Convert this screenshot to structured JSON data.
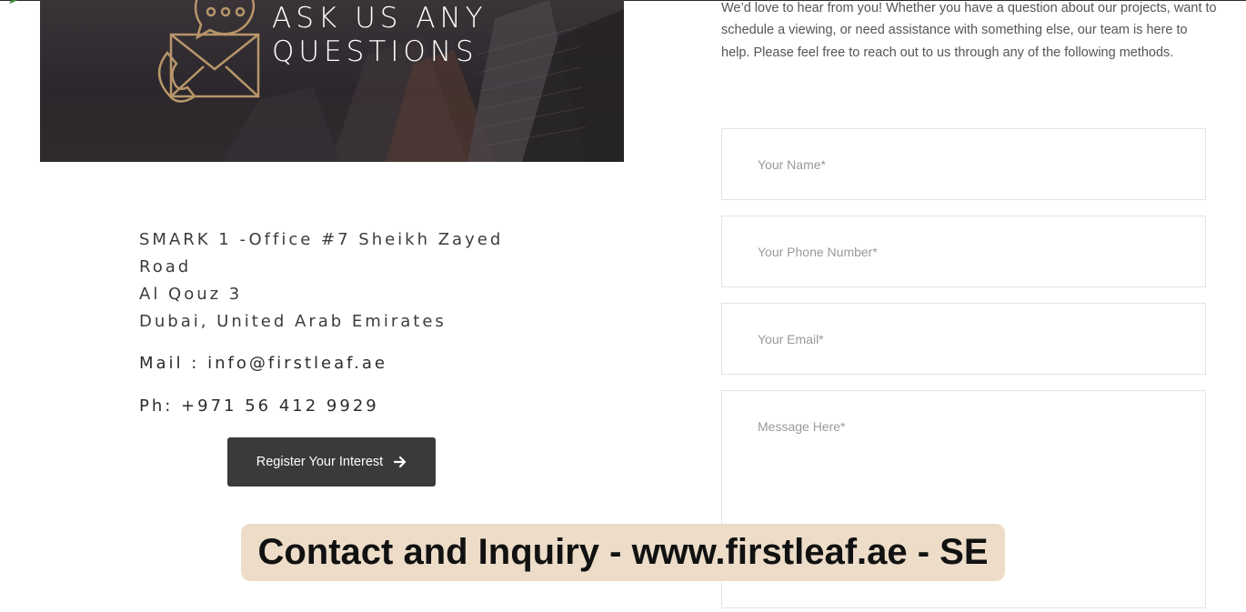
{
  "hero": {
    "title_line1": "ASK US ANY",
    "title_line2": "QUESTIONS",
    "icon": "envelope-chat-icon"
  },
  "contact": {
    "address_lines": [
      "SMARK 1 -Office #7 Sheikh Zayed",
      "Road",
      "Al Qouz 3",
      "Dubai, United Arab Emirates"
    ],
    "mail": "Mail : info@firstleaf.ae",
    "phone": "Ph: +971 56 412 9929"
  },
  "register_button": {
    "label": "Register Your Interest",
    "icon": "arrow-right-icon"
  },
  "intro_text": "We’d love to hear from you! Whether you have a question about our projects, want to schedule a viewing, or need assistance with something else, our team is here to help. Please feel free to reach out to us through any of the following methods.",
  "form": {
    "name_placeholder": "Your Name*",
    "phone_placeholder": "Your Phone Number*",
    "email_placeholder": "Your Email*",
    "message_placeholder": "Message Here*"
  },
  "caption": "Contact and Inquiry - www.firstleaf.ae - SE",
  "colors": {
    "hero_bg": "#2e2a2e",
    "icon_gold": "#b8966a",
    "button_bg": "#3a3a3a",
    "caption_bg": "#ecdcc8"
  }
}
